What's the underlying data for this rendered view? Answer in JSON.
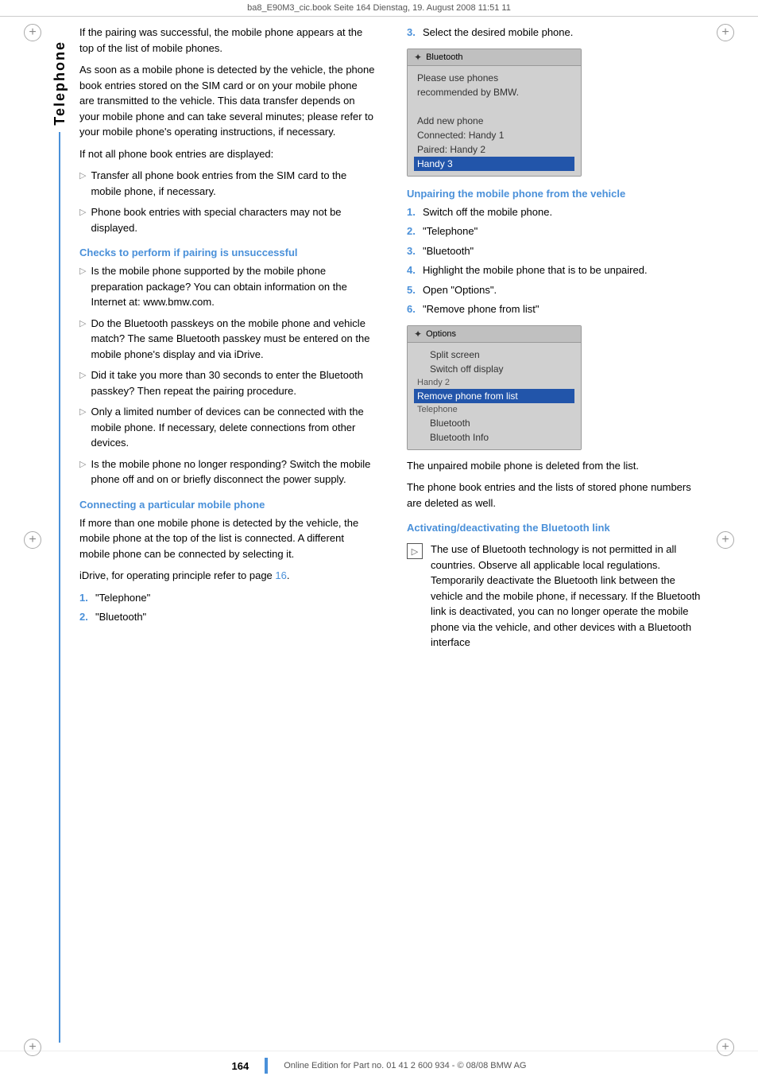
{
  "topbar": {
    "text": "ba8_E90M3_cic.book  Seite 164  Dienstag, 19. August 2008  11:51 11"
  },
  "sidebar": {
    "label": "Telephone"
  },
  "left": {
    "intro_p1": "If the pairing was successful, the mobile phone appears at the top of the list of mobile phones.",
    "intro_p2": "As soon as a mobile phone is detected by the vehicle, the phone book entries stored on the SIM card or on your mobile phone are transmitted to the vehicle. This data transfer depends on your mobile phone and can take several minutes; please refer to your mobile phone's operating instructions, if necessary.",
    "intro_p3": "If not all phone book entries are displayed:",
    "bullet1_1": "Transfer all phone book entries from the SIM card to the mobile phone, if necessary.",
    "bullet1_2": "Phone book entries with special characters may not be displayed.",
    "section1_heading": "Checks to perform if pairing is unsuccessful",
    "checks": [
      "Is the mobile phone supported by the mobile phone preparation package? You can obtain information on the Internet at: www.bmw.com.",
      "Do the Bluetooth passkeys on the mobile phone and vehicle match? The same Bluetooth passkey must be entered on the mobile phone's display and via iDrive.",
      "Did it take you more than 30 seconds to enter the Bluetooth passkey? Then repeat the pairing procedure.",
      "Only a limited number of devices can be connected with the mobile phone. If necessary, delete connections from other devices.",
      "Is the mobile phone no longer responding? Switch the mobile phone off and on or briefly disconnect the power supply."
    ],
    "section2_heading": "Connecting a particular mobile phone",
    "connect_p1": "If more than one mobile phone is detected by the vehicle, the mobile phone at the top of the list is connected. A different mobile phone can be connected by selecting it.",
    "connect_p2": "iDrive, for operating principle refer to page 16.",
    "connect_steps": [
      "\"Telephone\"",
      "\"Bluetooth\""
    ]
  },
  "right": {
    "step3_label": "3.",
    "step3_text": "Select the desired mobile phone.",
    "bluetooth_screen": {
      "title": "Bluetooth",
      "lines": [
        {
          "text": "Please use phones",
          "style": "normal"
        },
        {
          "text": "recommended by BMW.",
          "style": "normal"
        },
        {
          "text": "",
          "style": "normal"
        },
        {
          "text": "Add new phone",
          "style": "normal"
        },
        {
          "text": "Connected:   Handy 1",
          "style": "normal"
        },
        {
          "text": "Paired:        Handy 2",
          "style": "normal"
        },
        {
          "text": "Handy 3",
          "style": "highlight"
        }
      ]
    },
    "section3_heading": "Unpairing the mobile phone from the vehicle",
    "unpair_steps": [
      "Switch off the mobile phone.",
      "\"Telephone\"",
      "\"Bluetooth\"",
      "Highlight the mobile phone that is to be unpaired.",
      "Open \"Options\".",
      "\"Remove phone from list\""
    ],
    "options_screen": {
      "title": "Options",
      "lines": [
        {
          "text": "Split screen",
          "style": "indent"
        },
        {
          "text": "Switch off display",
          "style": "indent"
        },
        {
          "text": "Handy 2",
          "style": "section"
        },
        {
          "text": "Remove phone from list",
          "style": "highlight"
        },
        {
          "text": "Telephone",
          "style": "section"
        },
        {
          "text": "Bluetooth",
          "style": "indent"
        },
        {
          "text": "Bluetooth Info",
          "style": "indent"
        }
      ]
    },
    "after_unpair_p1": "The unpaired mobile phone is deleted from the list.",
    "after_unpair_p2": "The phone book entries and the lists of stored phone numbers are deleted as well.",
    "section4_heading": "Activating/deactivating the Bluetooth link",
    "note_text": "The use of Bluetooth technology is not permitted in all countries. Observe all applicable local regulations. Temporarily deactivate the Bluetooth link between the vehicle and the mobile phone, if necessary. If the Bluetooth link is deactivated, you can no longer operate the mobile phone via the vehicle, and other devices with a Bluetooth interface"
  },
  "footer": {
    "page": "164",
    "text": "Online Edition for Part no. 01 41 2 600 934 - © 08/08 BMW AG"
  }
}
